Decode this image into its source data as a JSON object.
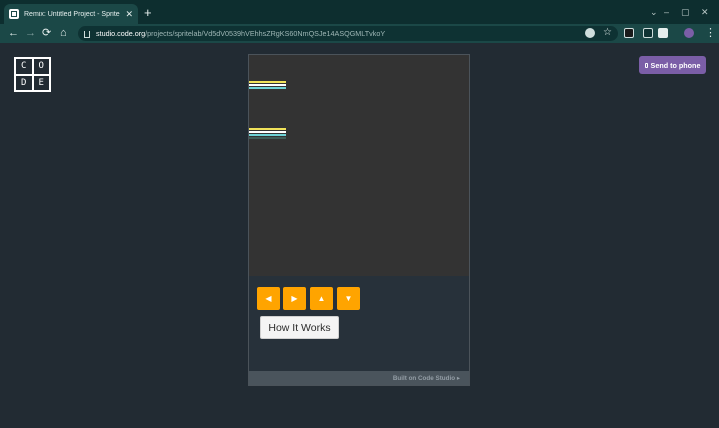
{
  "browser": {
    "tab_title": "Remix: Untitled Project - Sprite L",
    "tab_close": "✕",
    "new_tab": "+",
    "url_host": "studio.code.org",
    "url_path": "/projects/spritelab/Vd5dV0539hVEhhsZRgKS60NmQSJe14ASQGMLTvkoY",
    "window_controls": [
      "⌄",
      "–",
      "▢",
      "✕"
    ],
    "nav": {
      "back": "←",
      "forward": "→",
      "reload": "⟳",
      "home": "⌂",
      "menu": "⋮",
      "bookmark": "☆"
    }
  },
  "page": {
    "logo_letters": [
      "C",
      "O",
      "D",
      "E"
    ],
    "send_to_phone": "Send to phone",
    "controls": {
      "left": "◀",
      "right": "▶",
      "up": "▲",
      "down": "▼"
    },
    "how_it_works": "How It Works",
    "footer": "Built on Code Studio ▸"
  },
  "colors": {
    "accent_dpad": "#ffa400",
    "send_button": "#7b5ea7",
    "stage": "#333333",
    "sprite_stripes": [
      "#f1e35a",
      "#ffffff",
      "#6fd3d6"
    ]
  }
}
